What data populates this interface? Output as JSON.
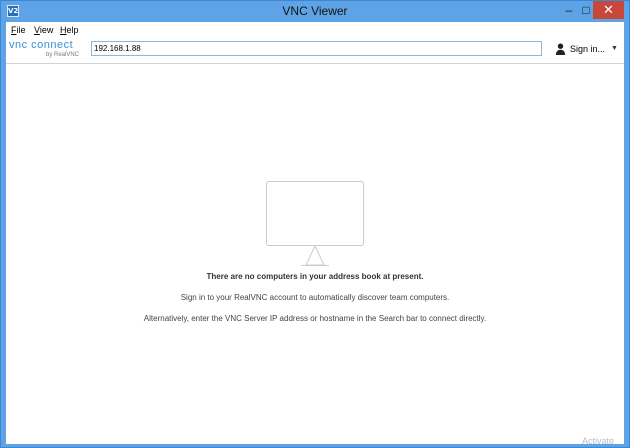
{
  "window": {
    "title": "VNC Viewer",
    "minimize_glyph": "–",
    "maximize_glyph": "□",
    "close_glyph": "✕"
  },
  "app_icon": {
    "text": "V2"
  },
  "menu": {
    "items": [
      {
        "label": "File"
      },
      {
        "label": "View"
      },
      {
        "label": "Help"
      }
    ]
  },
  "toolbar": {
    "logo_text": "vnc connect",
    "logo_subtext": "by RealVNC",
    "address_value": "192.168.1.88",
    "signin_label": "Sign in...",
    "signin_caret": "▼"
  },
  "main": {
    "headline": "There are no computers in your address book at present.",
    "line1": "Sign in to your RealVNC account to automatically discover team computers.",
    "line2": "Alternatively, enter the VNC Server IP address or hostname in the Search bar to connect directly."
  },
  "watermark": {
    "text": "Activate"
  },
  "colors": {
    "titlebar": "#5ea3e6",
    "close_button": "#c7473a",
    "logo_accent": "#3b8fd8"
  },
  "icons": [
    "app-icon",
    "person-icon",
    "monitor-icon"
  ]
}
